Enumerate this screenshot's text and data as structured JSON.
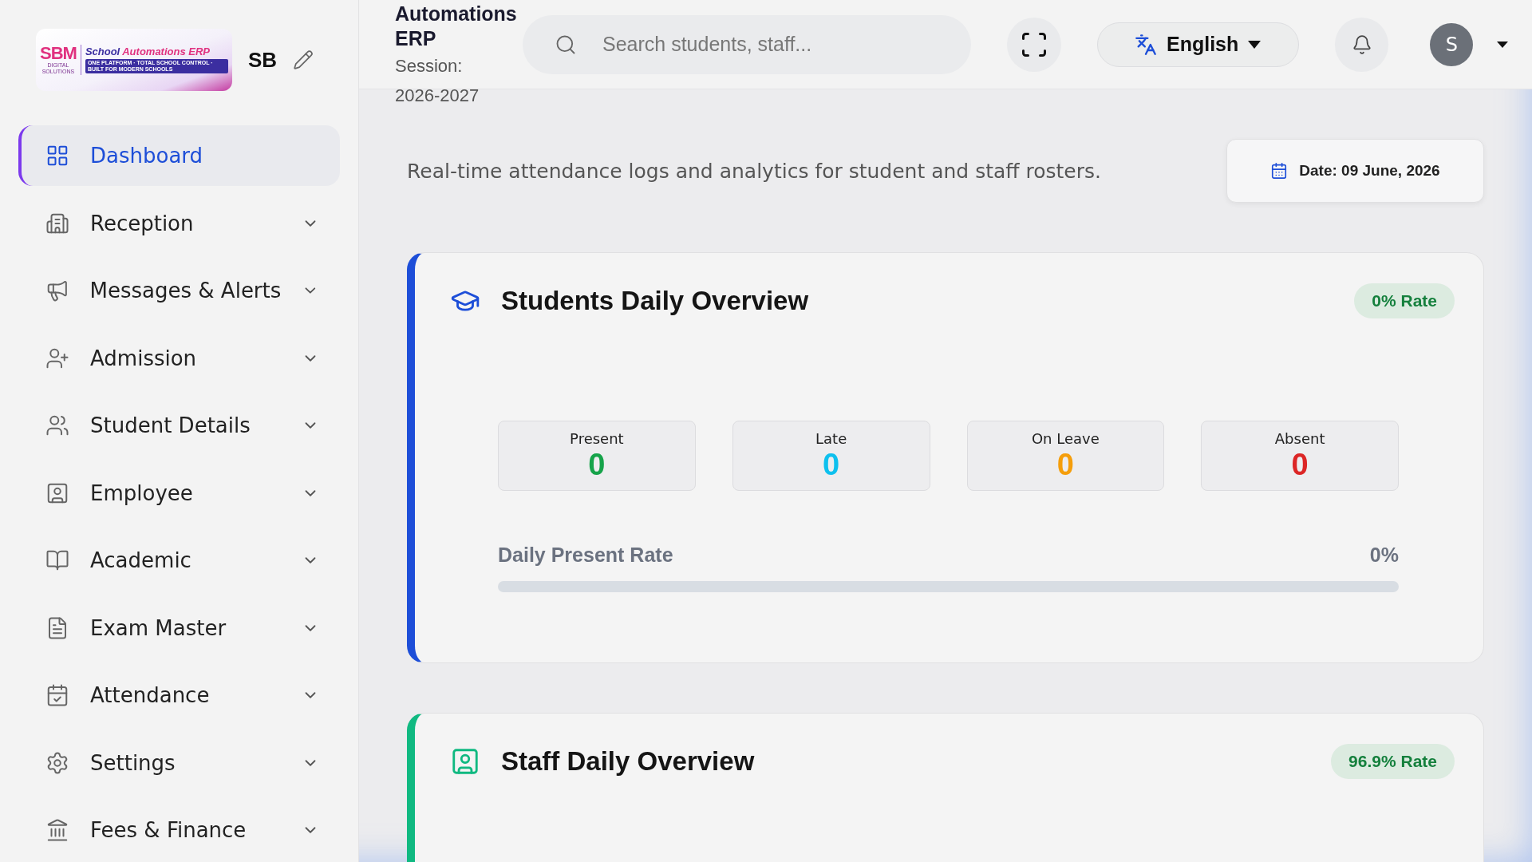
{
  "logo": {
    "brand": "SBM",
    "brand_sub": "DIGITAL SOLUTIONS",
    "title_1": "School",
    "title_2": "Automations ERP",
    "tagline": "ONE PLATFORM · TOTAL SCHOOL CONTROL · BUILT FOR MODERN SCHOOLS"
  },
  "school_short": "SB",
  "sidebar": {
    "items": [
      {
        "label": "Dashboard",
        "selected": true,
        "expandable": false
      },
      {
        "label": "Reception",
        "selected": false,
        "expandable": true
      },
      {
        "label": "Messages & Alerts",
        "selected": false,
        "expandable": true
      },
      {
        "label": "Admission",
        "selected": false,
        "expandable": true
      },
      {
        "label": "Student Details",
        "selected": false,
        "expandable": true
      },
      {
        "label": "Employee",
        "selected": false,
        "expandable": true
      },
      {
        "label": "Academic",
        "selected": false,
        "expandable": true
      },
      {
        "label": "Exam Master",
        "selected": false,
        "expandable": true
      },
      {
        "label": "Attendance",
        "selected": false,
        "expandable": true
      },
      {
        "label": "Settings",
        "selected": false,
        "expandable": true
      },
      {
        "label": "Fees & Finance",
        "selected": false,
        "expandable": true
      }
    ]
  },
  "header": {
    "title": "Automations ERP",
    "session_label": "Session:",
    "session": "2026-2027",
    "search": {
      "placeholder": "Search students, staff..."
    },
    "language": "English",
    "avatar": "S"
  },
  "description": "Real-time attendance logs and analytics for student and staff rosters.",
  "date": "Date: 09 June, 2026",
  "overviews": [
    {
      "title": "Students Daily Overview",
      "rate": "0% Rate",
      "color": "#1d4ed8",
      "stats": [
        {
          "label": "Present",
          "value": "0",
          "color": "#16a34a"
        },
        {
          "label": "Late",
          "value": "0",
          "color": "#0ec0ee"
        },
        {
          "label": "On Leave",
          "value": "0",
          "color": "#f59e0b"
        },
        {
          "label": "Absent",
          "value": "0",
          "color": "#dc2626"
        }
      ],
      "progress": {
        "label": "Daily Present Rate",
        "value": "0%",
        "level": 0
      }
    },
    {
      "title": "Staff Daily Overview",
      "rate": "96.9% Rate",
      "color": "#10b981"
    }
  ]
}
